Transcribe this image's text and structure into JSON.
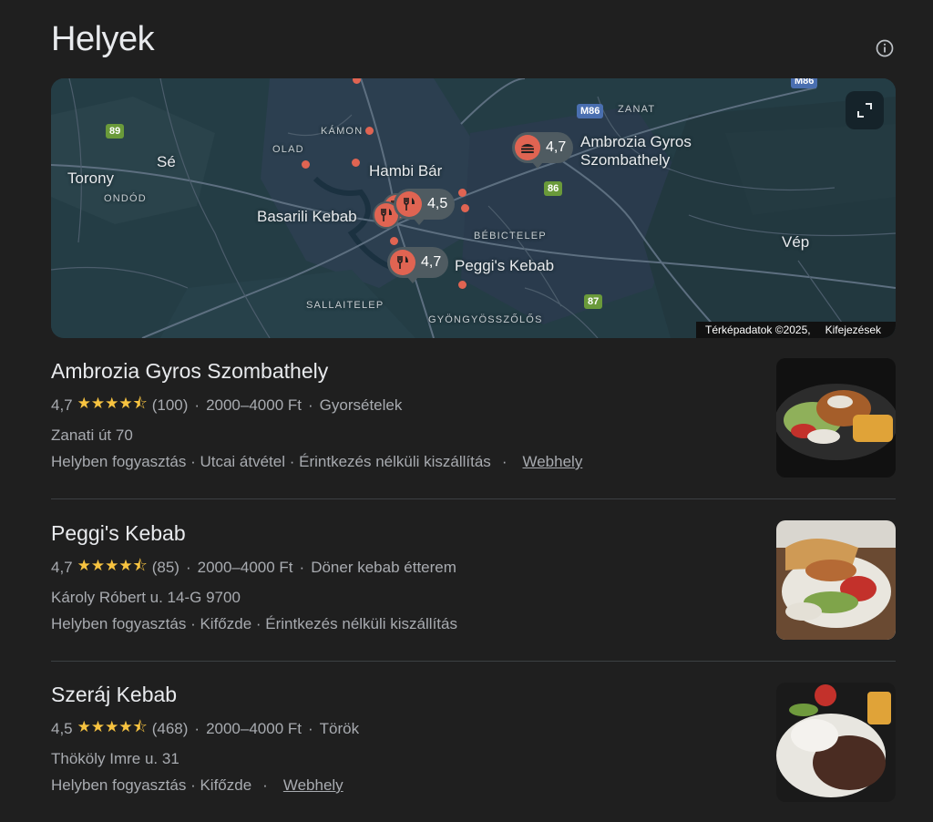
{
  "page": {
    "title": "Helyek"
  },
  "map": {
    "attribution": "Térképadatok ©2025,",
    "terms": "Kifejezések",
    "labels": {
      "torony": "Torony",
      "se": "Sé",
      "ondod": "ONDÓD",
      "kamon": "KÁMON",
      "olad": "OLAD",
      "zanat": "ZANAT",
      "hambi": "Hambi Bár",
      "basarili": "Basarili Kebab",
      "ambrozia": "Ambrozia Gyros\nSzombathely",
      "bebictelep": "BÉBICTELEP",
      "vep": "Vép",
      "peggis": "Peggi's Kebab",
      "sallaitelep": "SALLAITELEP",
      "gyongyosszolos": "GYÖNGYÖSSZŐLŐS"
    },
    "roads": {
      "r89": "89",
      "m86": "M86",
      "r86": "86",
      "r87": "87",
      "m86b": "M86"
    },
    "pins": {
      "ambrozia": "4,7",
      "hambi": "4,5",
      "peggis": "4,7"
    },
    "colors": {
      "water": "#243d45",
      "pin": "#e06452"
    }
  },
  "results": [
    {
      "name": "Ambrozia Gyros Szombathely",
      "rating": "4,7",
      "stars": "★★★★⯪",
      "reviews": "(100)",
      "price": "2000–4000 Ft",
      "category": "Gyorsételek",
      "address": "Zanati út 70",
      "services": "Helyben fogyasztás · Utcai átvétel · Érintkezés nélküli kiszállítás",
      "website": "Webhely"
    },
    {
      "name": "Peggi's Kebab",
      "rating": "4,7",
      "stars": "★★★★⯪",
      "reviews": "(85)",
      "price": "2000–4000 Ft",
      "category": "Döner kebab étterem",
      "address": "Károly Róbert u. 14-G 9700",
      "services": "Helyben fogyasztás · Kifőzde · Érintkezés nélküli kiszállítás"
    },
    {
      "name": "Szeráj Kebab",
      "rating": "4,5",
      "stars": "★★★★⯪",
      "reviews": "(468)",
      "price": "2000–4000 Ft",
      "category": "Török",
      "address": "Thököly Imre u. 31",
      "services": "Helyben fogyasztás · Kifőzde",
      "website": "Webhely"
    }
  ],
  "icons": {
    "info": "info-icon",
    "expand": "expand-icon",
    "restaurant": "fork-knife-icon",
    "fastfood": "fastfood-icon"
  }
}
